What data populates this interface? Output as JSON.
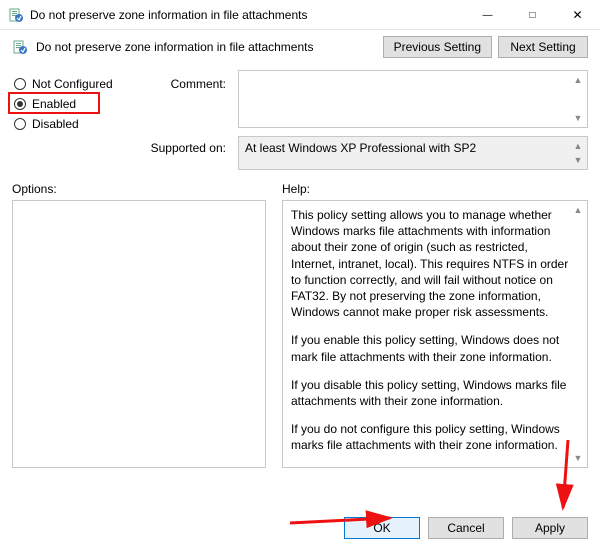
{
  "titlebar": {
    "title": "Do not preserve zone information in file attachments"
  },
  "header": {
    "title": "Do not preserve zone information in file attachments",
    "previous_label": "Previous Setting",
    "next_label": "Next Setting"
  },
  "state": {
    "not_configured_label": "Not Configured",
    "enabled_label": "Enabled",
    "disabled_label": "Disabled",
    "selected": "enabled"
  },
  "labels": {
    "comment": "Comment:",
    "supported": "Supported on:",
    "options": "Options:",
    "help": "Help:"
  },
  "supported_text": "At least Windows XP Professional with SP2",
  "help": {
    "p1": "This policy setting allows you to manage whether Windows marks file attachments with information about their zone of origin (such as restricted, Internet, intranet, local). This requires NTFS in order to function correctly, and will fail without notice on FAT32. By not preserving the zone information, Windows cannot make proper risk assessments.",
    "p2": "If you enable this policy setting, Windows does not mark file attachments with their zone information.",
    "p3": "If you disable this policy setting, Windows marks file attachments with their zone information.",
    "p4": "If you do not configure this policy setting, Windows marks file attachments with their zone information."
  },
  "footer": {
    "ok": "OK",
    "cancel": "Cancel",
    "apply": "Apply"
  }
}
